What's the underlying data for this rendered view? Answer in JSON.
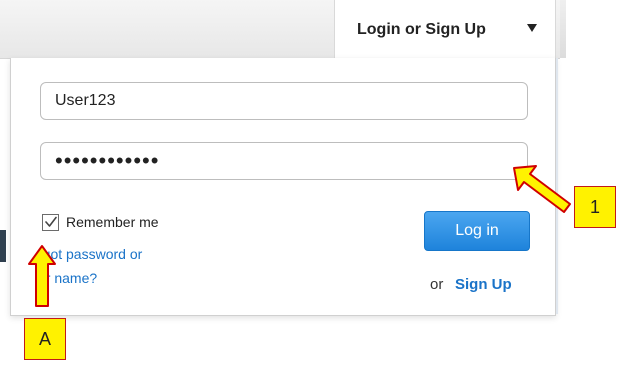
{
  "header": {
    "login_menu_label": "Login or Sign Up"
  },
  "form": {
    "username_value": "User123",
    "password_value": "••••••••••••",
    "remember_label": "Remember me",
    "remember_checked": true,
    "forgot_line_1": "rgot password or",
    "forgot_line_2": "er name?",
    "login_button_label": "Log in",
    "or_text": "or",
    "signup_label": "Sign Up"
  },
  "annotations": {
    "callout_1": "1",
    "callout_a": "A"
  },
  "colors": {
    "link_blue": "#1a73c8",
    "button_blue": "#1e83db",
    "callout_yellow": "#fff200",
    "callout_border": "#c11a1a"
  },
  "icons": {
    "dropdown_caret": "caret-down-icon",
    "checkbox_mark": "check-mark-icon",
    "annotation_arrow_1": "arrow-left-up-icon",
    "annotation_arrow_a": "arrow-up-icon"
  }
}
